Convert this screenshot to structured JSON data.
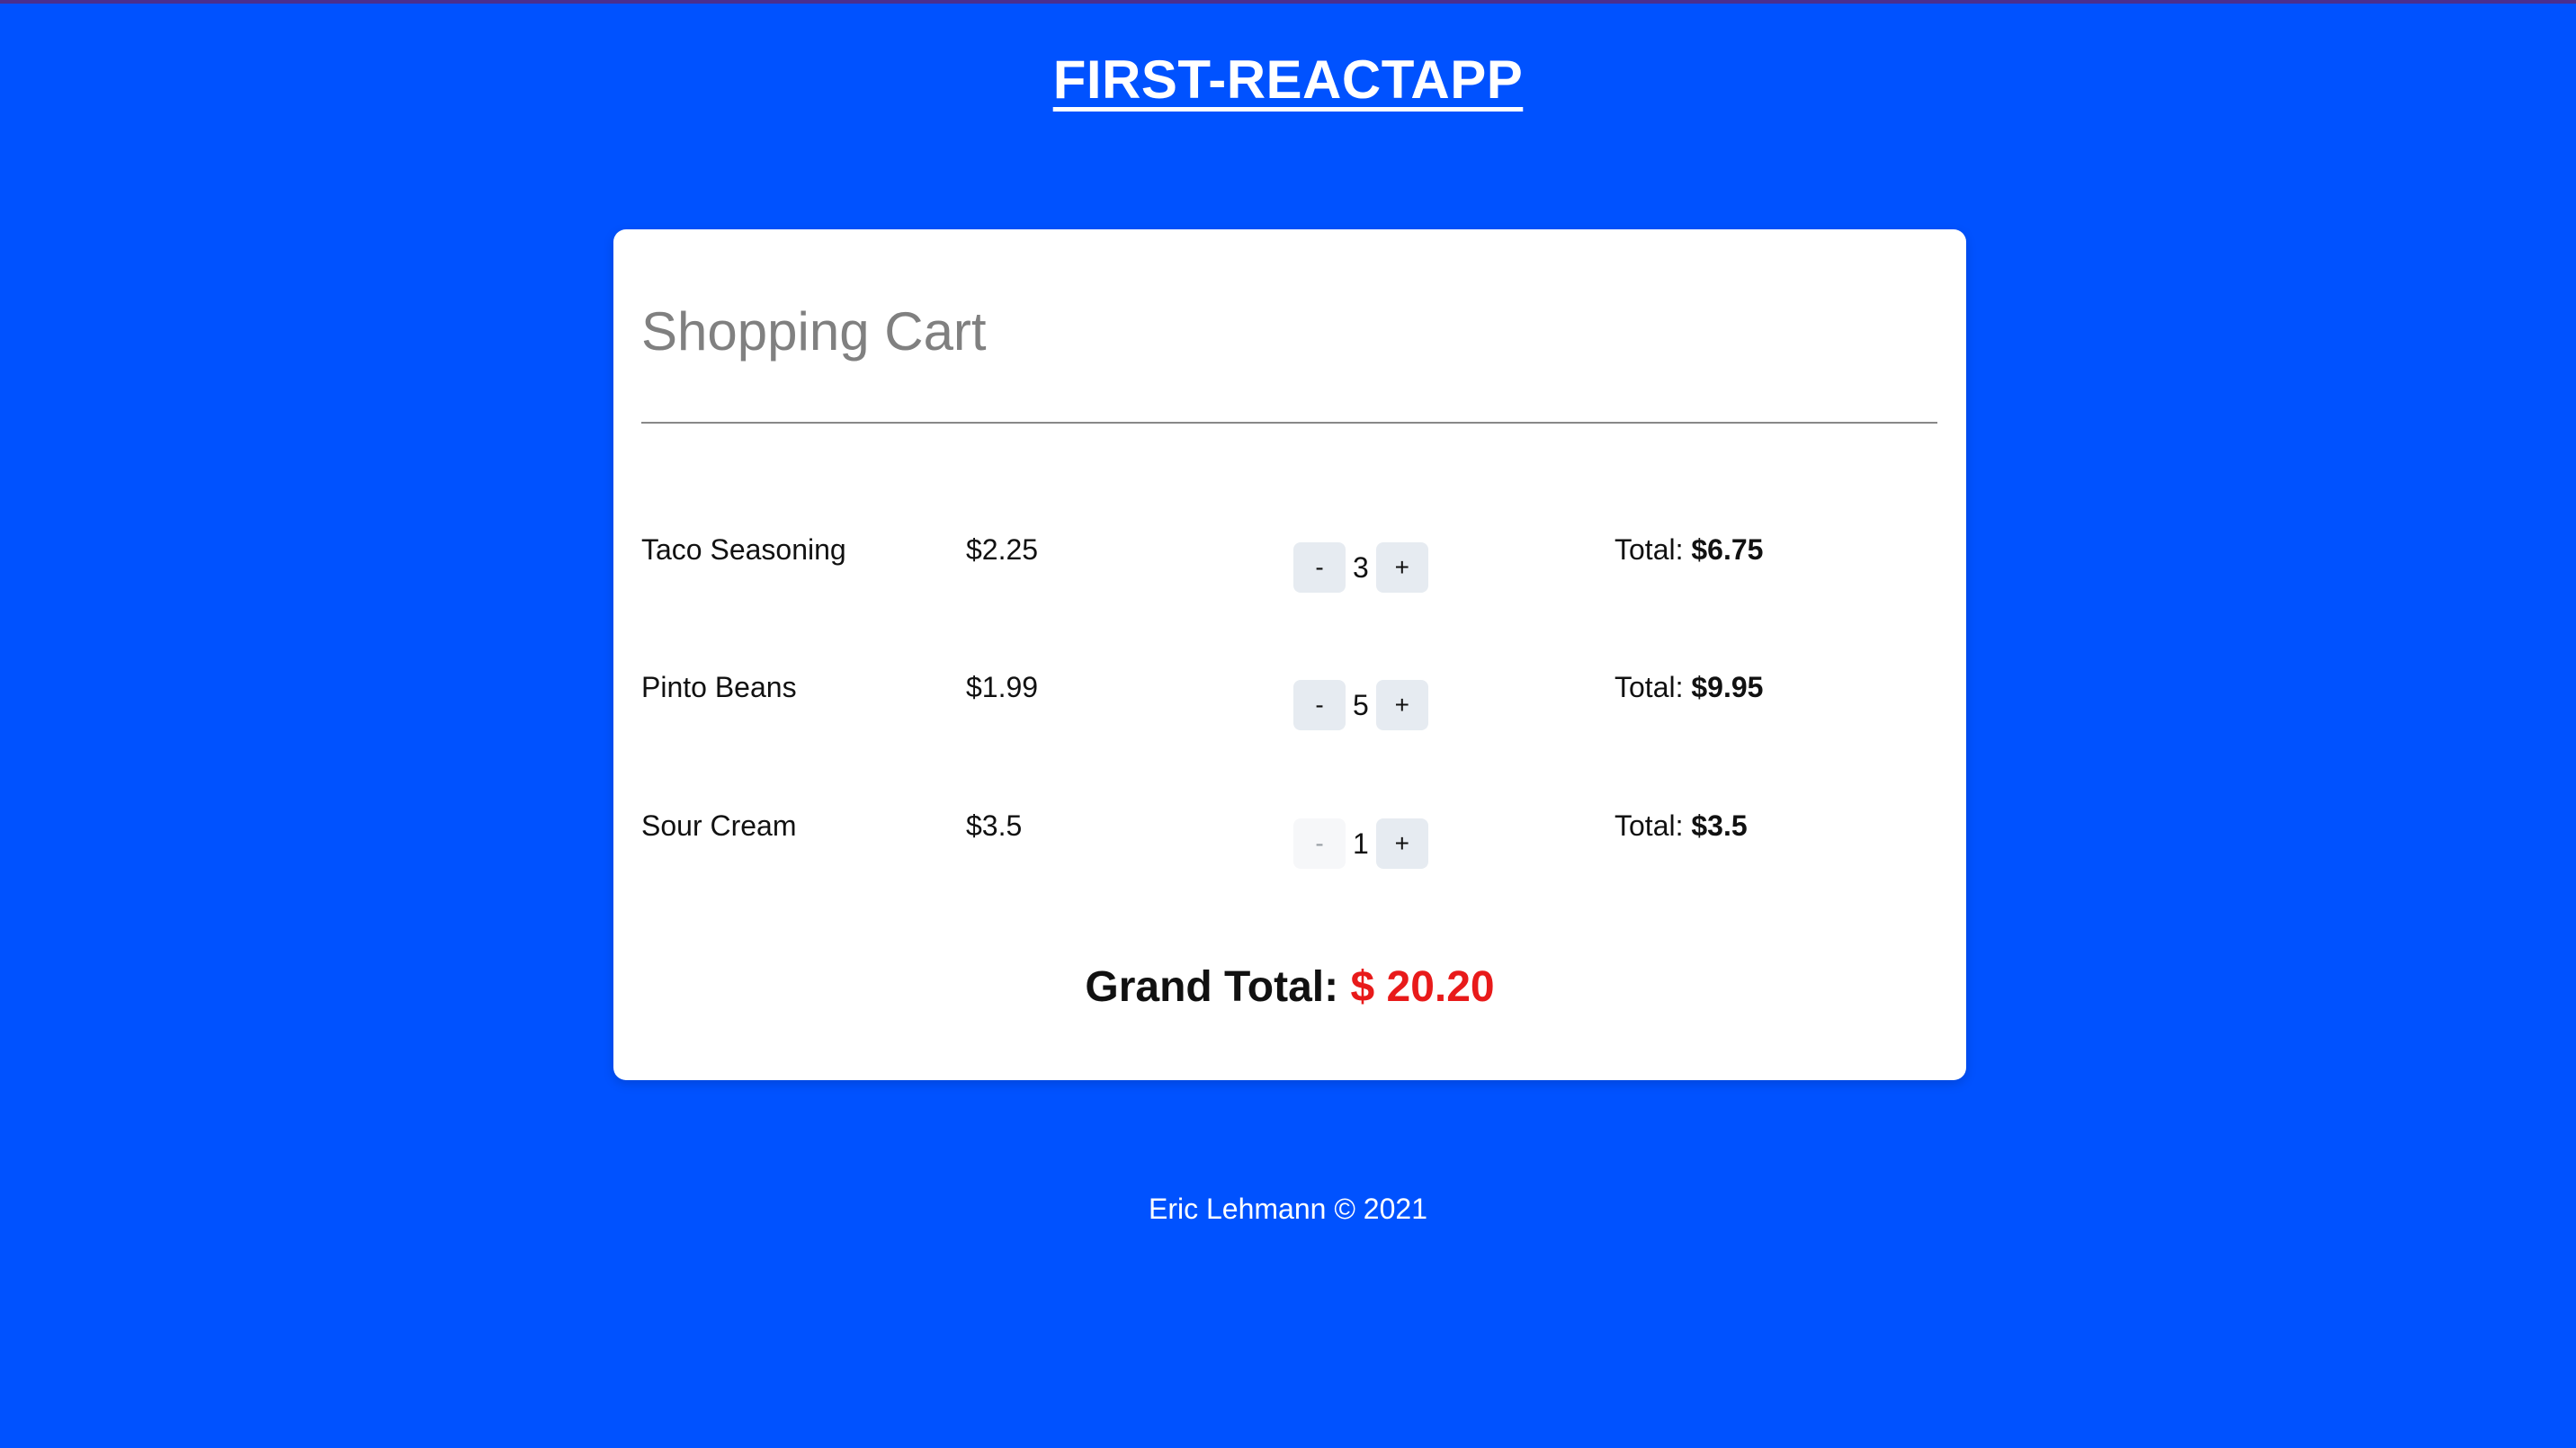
{
  "header": {
    "title": "FIRST-REACTAPP"
  },
  "cart": {
    "heading": "Shopping Cart",
    "total_prefix": "Total: ",
    "items": [
      {
        "name": "Taco Seasoning",
        "price": "$2.25",
        "quantity": "3",
        "total": "$6.75"
      },
      {
        "name": "Pinto Beans",
        "price": "$1.99",
        "quantity": "5",
        "total": "$9.95"
      },
      {
        "name": "Sour Cream",
        "price": "$3.5",
        "quantity": "1",
        "total": "$3.5"
      }
    ],
    "decrement_label": "-",
    "increment_label": "+",
    "grand_total_label": "Grand Total: ",
    "grand_total_value": "$ 20.20"
  },
  "footer": {
    "text": "Eric Lehmann © 2021"
  },
  "colors": {
    "background": "#0052ff",
    "card": "#ffffff",
    "grand_total_amount": "#e81a1a",
    "qty_button": "#e6ebf1"
  }
}
